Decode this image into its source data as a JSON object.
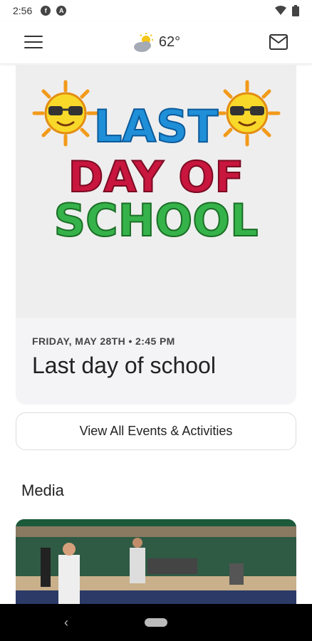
{
  "status_bar": {
    "time": "2:56",
    "icon1": "f",
    "icon2": "A"
  },
  "header": {
    "temperature": "62°",
    "weather_icon": "partly-cloudy-icon"
  },
  "event_card": {
    "banner_line1": "LAST",
    "banner_line2": "DAY OF",
    "banner_line3": "SCHOOL",
    "date": "FRIDAY, MAY 28TH • 2:45 PM",
    "title": "Last day of school"
  },
  "view_all_label": "View All Events & Activities",
  "media": {
    "section_title": "Media"
  },
  "colors": {
    "accent": "#e84a9c",
    "background": "#ffffff",
    "card": "#f4f4f6"
  }
}
